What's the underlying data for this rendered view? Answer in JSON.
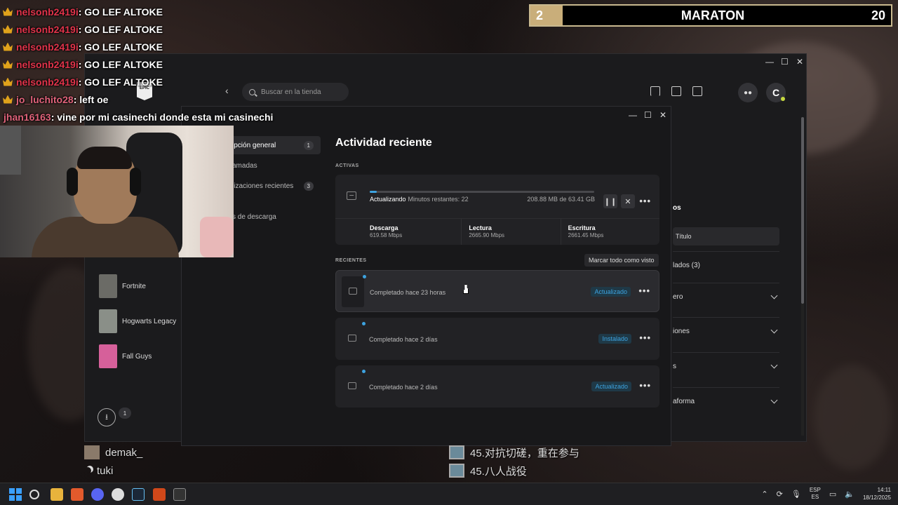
{
  "chat": [
    {
      "user": "nelsonb2419i",
      "msg": ": GO LEF ALTOKE",
      "crown": true,
      "color": "red"
    },
    {
      "user": "nelsonb2419i",
      "msg": ": GO LEF ALTOKE",
      "crown": true,
      "color": "red"
    },
    {
      "user": "nelsonb2419i",
      "msg": ": GO LEF ALTOKE",
      "crown": true,
      "color": "red"
    },
    {
      "user": "nelsonb2419i",
      "msg": ": GO LEF ALTOKE",
      "crown": true,
      "color": "red"
    },
    {
      "user": "nelsonb2419i",
      "msg": ": GO LEF ALTOKE",
      "crown": true,
      "color": "red"
    },
    {
      "user": "jo_luchito28",
      "msg": ": left oe",
      "crown": true,
      "color": "pink"
    },
    {
      "user": "jhan16163",
      "msg": ": vine por mi casinechi donde esta mi casinechi",
      "crown": false,
      "color": "pink"
    }
  ],
  "maraton": {
    "left": "2",
    "label": "MARATON",
    "right": "20"
  },
  "launcher": {
    "search_placeholder": "Buscar en la tienda",
    "avatar_letter": "C",
    "library_games": [
      {
        "name": "Fortnite",
        "color": "#6b6b66"
      },
      {
        "name": "Hogwarts Legacy",
        "color": "#8a8f88"
      },
      {
        "name": "Fall Guys",
        "color": "#d6609a"
      }
    ],
    "download_badge": "1",
    "right_panel": {
      "heading_fragment": "os",
      "sort_value": "Título",
      "items": [
        "lados (3)",
        "ero",
        "iones",
        "s",
        "aforma"
      ]
    }
  },
  "dialog": {
    "nav": [
      {
        "label": "ipción general",
        "count": "1"
      },
      {
        "label": "amadas",
        "count": ""
      },
      {
        "label": "lizaciones recientes",
        "count": "3"
      },
      {
        "label": "s de descarga",
        "count": ""
      }
    ],
    "title": "Actividad reciente",
    "active_label": "ACTIVAS",
    "active": {
      "status": "Actualizando",
      "remaining": "Minutos restantes: 22",
      "size": "208.88 MB de 63.41 GB",
      "progress": 0.0033,
      "stats": [
        {
          "label": "Descarga",
          "value": "619.58 Mbps"
        },
        {
          "label": "Lectura",
          "value": "2665.90 Mbps"
        },
        {
          "label": "Escritura",
          "value": "2661.45 Mbps"
        }
      ]
    },
    "recent_label": "RECIENTES",
    "mark_all": "Marcar todo como visto",
    "recent": [
      {
        "text": "Completado hace 23 horas",
        "badge": "Actualizado"
      },
      {
        "text": "Completado hace 2 días",
        "badge": "Instalado"
      },
      {
        "text": "Completado hace 2 días",
        "badge": "Actualizado"
      }
    ]
  },
  "bottom_chat_left": [
    "demak_",
    "tuki"
  ],
  "bottom_chat_right": [
    "45.对抗切磋，重在参与",
    "45.八人战役"
  ],
  "taskbar": {
    "lang_top": "ESP",
    "lang_bottom": "ES",
    "time": "14:11",
    "date": "18/12/2025"
  },
  "colors": {
    "accent": "#3da3e0",
    "chat_user": "#e0334a",
    "maraton_border": "#c9b98f"
  }
}
